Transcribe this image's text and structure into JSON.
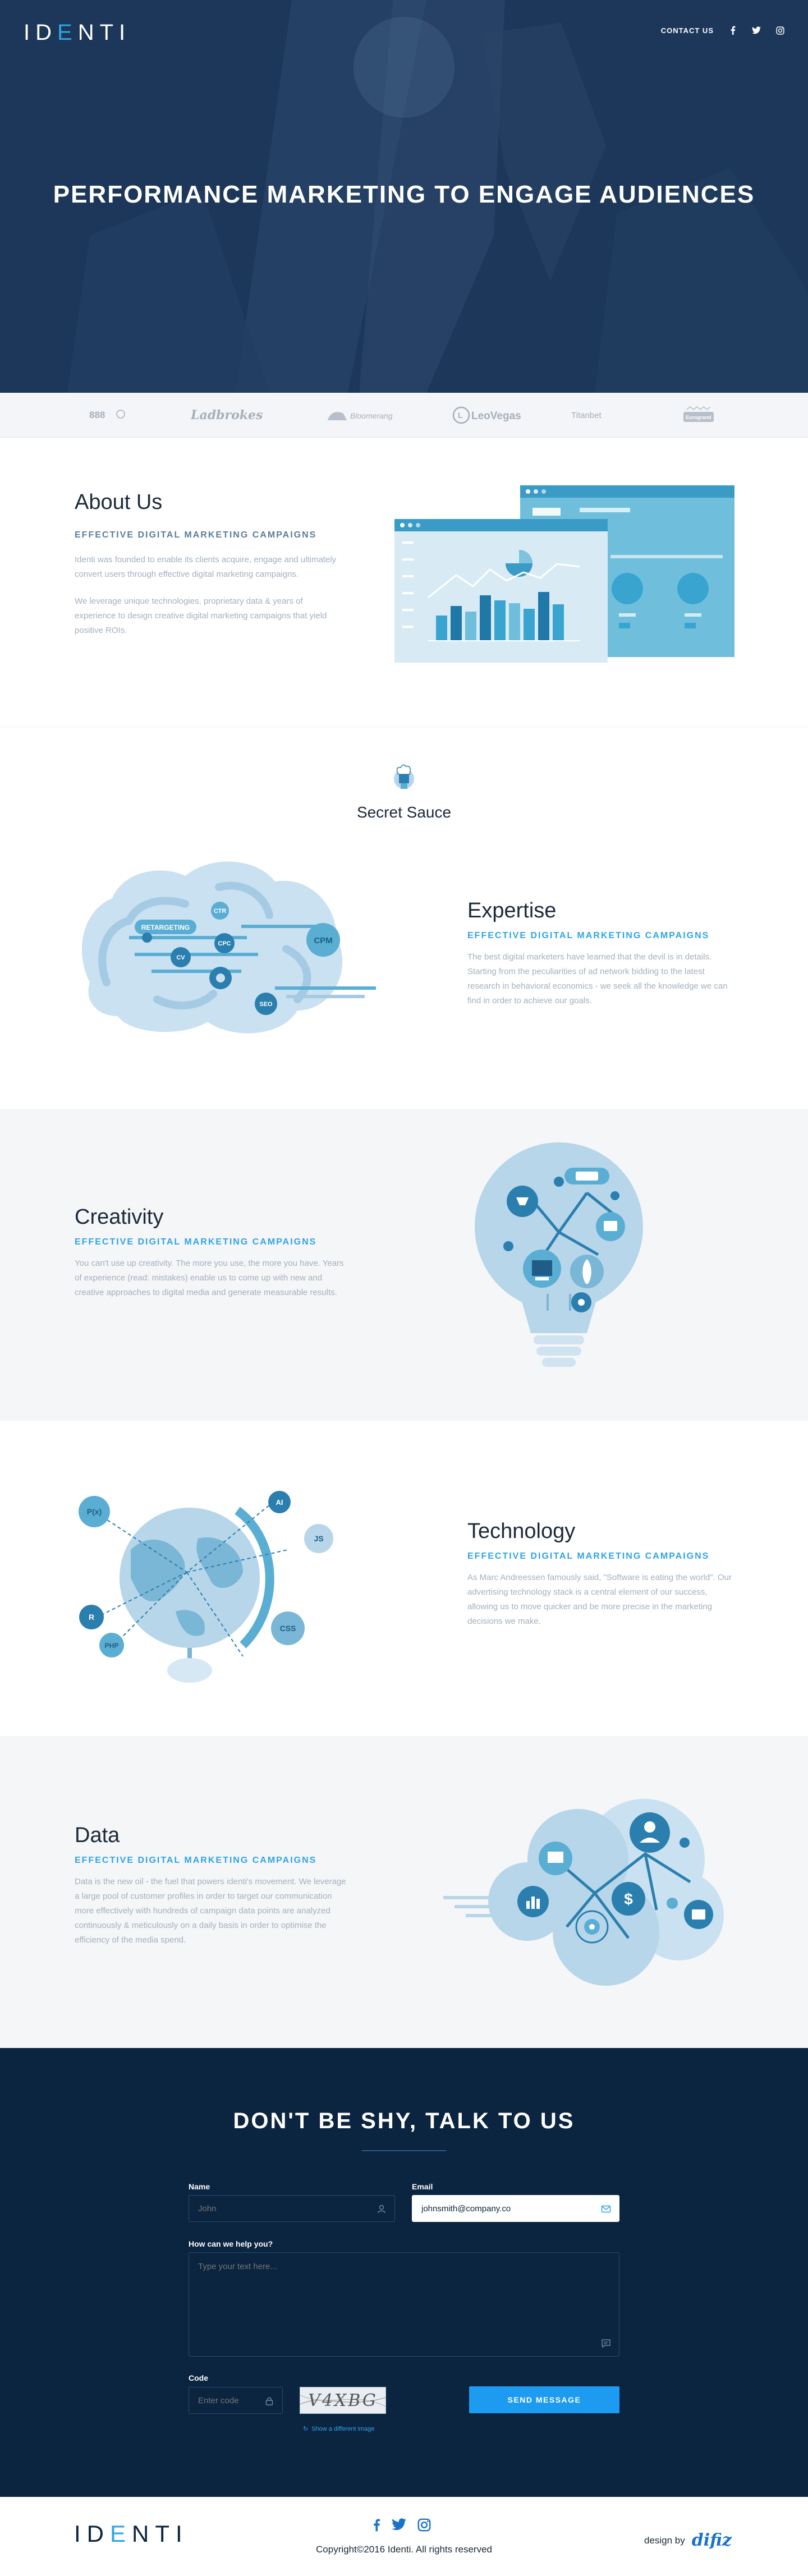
{
  "header": {
    "logo_pre": "ID",
    "logo_accent": "E",
    "logo_post": "NTI",
    "nav_contact": "CONTACT US",
    "social_icons": [
      "facebook-icon",
      "twitter-icon",
      "instagram-icon"
    ]
  },
  "hero": {
    "title": "PERFORMANCE MARKETING TO ENGAGE AUDIENCES"
  },
  "clients": [
    "888",
    "Ladbrokes",
    "Bloomerang",
    "LeoVegas",
    "Titanbet",
    "Eurogrand"
  ],
  "about": {
    "title": "About Us",
    "subhead": "EFFECTIVE DIGITAL MARKETING CAMPAIGNS",
    "para1": "Identi was founded to enable its clients acquire, engage and ultimately convert users through effective digital marketing campaigns.",
    "para2": "We leverage unique technologies, proprietary data & years of experience to design creative digital marketing campaigns that yield positive ROIs."
  },
  "sauce": {
    "title": "Secret Sauce"
  },
  "expertise": {
    "title": "Expertise",
    "subhead": "EFFECTIVE DIGITAL MARKETING CAMPAIGNS",
    "para": "The best digital marketers have learned that the devil is in details. Starting from the peculiarities of ad network bidding to the latest research in behavioral economics - we seek all the knowledge we can find in order to achieve our goals.",
    "bubbles": [
      "CTR",
      "RETARGETING",
      "CV",
      "CPC",
      "CPM",
      "SEO"
    ]
  },
  "creativity": {
    "title": "Creativity",
    "subhead": "EFFECTIVE DIGITAL MARKETING CAMPAIGNS",
    "para": "You can't use up creativity. The more you use, the more you have. Years of experience (read: mistakes) enable us to come up with new and creative approaches to digital media and generate measurable results."
  },
  "technology": {
    "title": "Technology",
    "subhead": "EFFECTIVE DIGITAL MARKETING CAMPAIGNS",
    "para": "As Marc Andreessen famously said, \"Software is eating the world\". Our advertising technology stack is a central element of our success, allowing us to move quicker and be more precise in the marketing decisions we make.",
    "bubbles": [
      "P(x)",
      "AI",
      "JS",
      "R",
      "CSS",
      "PHP"
    ]
  },
  "data_section": {
    "title": "Data",
    "subhead": "EFFECTIVE DIGITAL MARKETING CAMPAIGNS",
    "para": "Data is the new oil - the fuel that powers identi's movement. We leverage a large pool of customer profiles in order to target our communication more effectively with hundreds of campaign data points are analyzed continuously & meticulously on a daily basis in order to optimise the efficiency of the media spend."
  },
  "contact": {
    "title": "DON'T BE SHY, TALK TO US",
    "name_label": "Name",
    "name_placeholder": "John",
    "email_label": "Email",
    "email_value": "johnsmith@company.co",
    "message_label": "How can we help you?",
    "message_placeholder": "Type your text here...",
    "code_label": "Code",
    "code_placeholder": "Enter code",
    "captcha_text": "V4XBG",
    "show_different": "Show a different image",
    "send_label": "SEND MESSAGE"
  },
  "footer": {
    "logo_pre": "ID",
    "logo_accent": "E",
    "logo_post": "NTI",
    "copyright": "Copyright©2016 Identi. All rights reserved",
    "design_by": "design by",
    "designer": "difiz"
  },
  "colors": {
    "accent": "#2fa4e7",
    "navy": "#0b2440",
    "illustration_light": "#b7d6ea",
    "illustration_mid": "#5aaed3",
    "illustration_dark": "#2a7fae"
  }
}
